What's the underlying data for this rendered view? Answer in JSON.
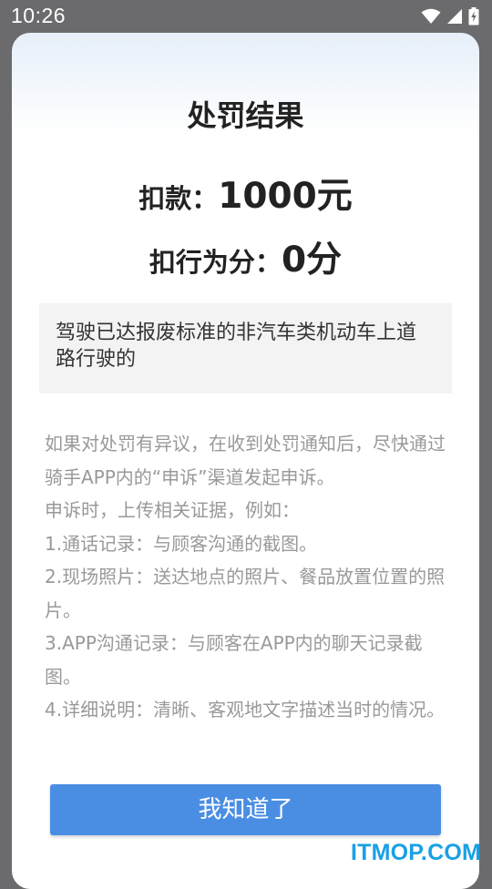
{
  "status_bar": {
    "time": "10:26",
    "icons": [
      "wifi-icon",
      "cellular-signal-icon",
      "battery-charging-icon"
    ]
  },
  "dialog": {
    "title": "处罚结果",
    "fine": {
      "label": "扣款：",
      "value": "1000元"
    },
    "points": {
      "label": "扣行为分：",
      "value": "0分"
    },
    "reason": "驾驶已达报废标准的非汽车类机动车上道路行驶的",
    "appeal_lines": [
      "如果对处罚有异议，在收到处罚通知后，尽快通过骑手APP内的“申诉”渠道发起申诉。",
      "申诉时，上传相关证据，例如：",
      "1.通话记录：与顾客沟通的截图。",
      "2.现场照片：送达地点的照片、餐品放置位置的照片。",
      "3.APP沟通记录：与顾客在APP内的聊天记录截图。",
      "4.详细说明：清晰、客观地文字描述当时的情况。"
    ],
    "button_label": "我知道了"
  },
  "watermark": "ITMOP.COM",
  "colors": {
    "button": "#4a8ee3",
    "backdrop": "#6b6b6e",
    "watermark": "#1aa0e4"
  }
}
